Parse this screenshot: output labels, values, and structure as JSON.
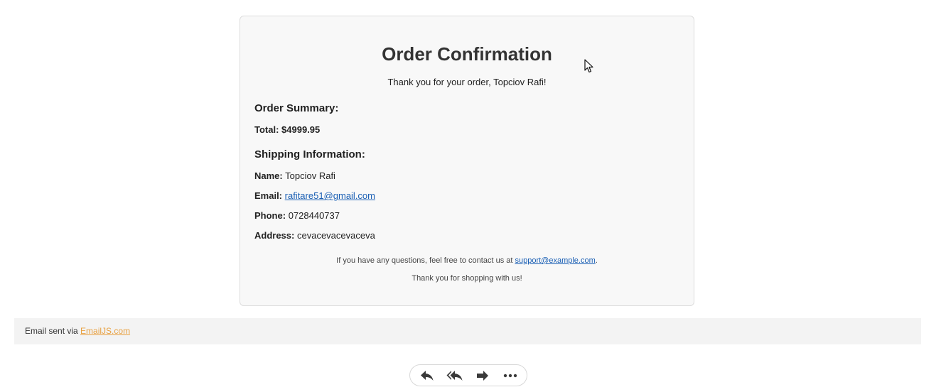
{
  "email": {
    "title": "Order Confirmation",
    "thanks": "Thank you for your order, Topciov Rafi!",
    "order_summary": {
      "heading": "Order Summary:",
      "total_label": "Total:",
      "total_value": "$4999.95"
    },
    "shipping": {
      "heading": "Shipping Information:",
      "name_label": "Name:",
      "name_value": "Topciov Rafi",
      "email_label": "Email:",
      "email_value": "rafitare51@gmail.com",
      "phone_label": "Phone:",
      "phone_value": "0728440737",
      "address_label": "Address:",
      "address_value": "cevacevacevaceva"
    },
    "footer": {
      "contact_prefix": "If you have any questions, feel free to contact us at",
      "contact_email": "support@example.com",
      "contact_suffix": ".",
      "closing": "Thank you for shopping with us!"
    }
  },
  "sent_via": {
    "prefix": "Email sent via",
    "link_text": "EmailJS.com"
  },
  "actions": [
    {
      "icon": "reply-icon"
    },
    {
      "icon": "reply-all-icon"
    },
    {
      "icon": "forward-icon"
    },
    {
      "icon": "more-icon"
    }
  ],
  "colors": {
    "card_background": "#f8f8f8",
    "link": "#1a5fb4",
    "emailjs_link": "#e8a040",
    "sent_bar_background": "#f3f3f3"
  }
}
